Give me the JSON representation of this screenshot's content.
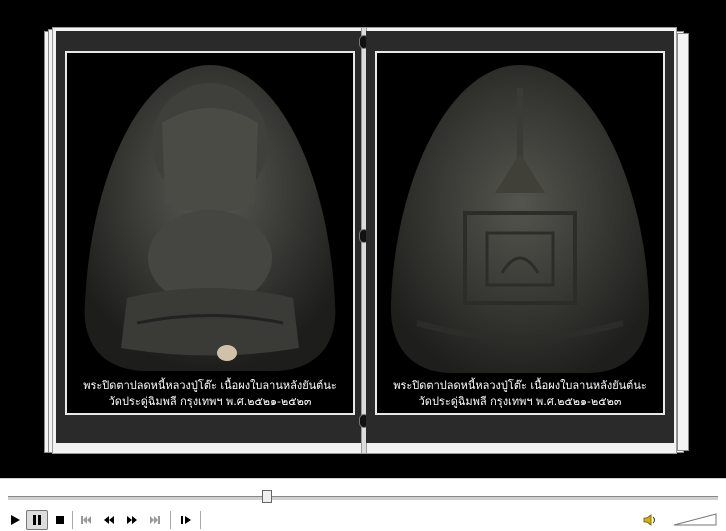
{
  "left_page": {
    "image_label": "Front of Phra Pidta amulet",
    "caption_line1": "พระปิดตาปลดหนี้หลวงปู่โต๊ะ เนื้อผงใบลานหลังยันต์นะ",
    "caption_line2": "วัดประดู่ฉิมพลี กรุงเทพฯ พ.ศ.๒๕๒๑-๒๕๒๓"
  },
  "right_page": {
    "image_label": "Back of Phra Pidta amulet",
    "caption_line1": "พระปิดตาปลดหนี้หลวงปู่โต๊ะ เนื้อผงใบลานหลังยันต์นะ",
    "caption_line2": "วัดประดู่ฉิมพลี กรุงเทพฯ พ.ศ.๒๕๒๑-๒๕๒๓"
  },
  "player": {
    "seek_position": 0.36,
    "state": "playing",
    "buttons": [
      "play-icon",
      "pause-icon",
      "stop-icon",
      "skip-back-icon",
      "rewind-icon",
      "fast-forward-icon",
      "skip-forward-icon",
      "step-icon"
    ],
    "volume_icon": "speaker-icon"
  },
  "colors": {
    "background": "#000000",
    "page": "#f2f2f2",
    "controls": "#ffffff"
  }
}
